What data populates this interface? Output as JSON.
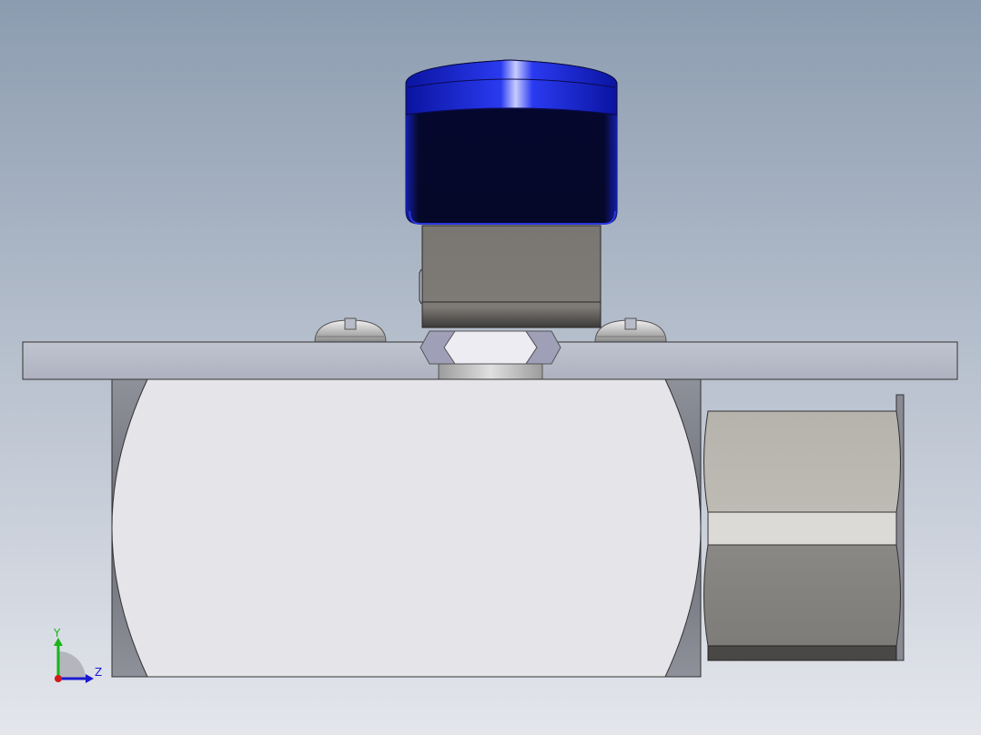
{
  "viewport": {
    "background_top": "#8c9cb0",
    "background_bottom": "#e4e6ec"
  },
  "model": {
    "knob_color": "#1a2bd6",
    "knob_dark": "#05061a",
    "stem_color": "#7c7874",
    "plate_color": "#b8bcc8",
    "body_face_color": "#e4e4e9",
    "body_edge_color": "#7e8088",
    "fitting_light": "#bab6b0",
    "fitting_dark": "#858380",
    "screw_color": "#cccccc"
  },
  "triad": {
    "y_label": "Y",
    "z_label": "Z",
    "y_color": "#19b419",
    "z_color": "#1919d2",
    "x_color": "#d21919"
  }
}
